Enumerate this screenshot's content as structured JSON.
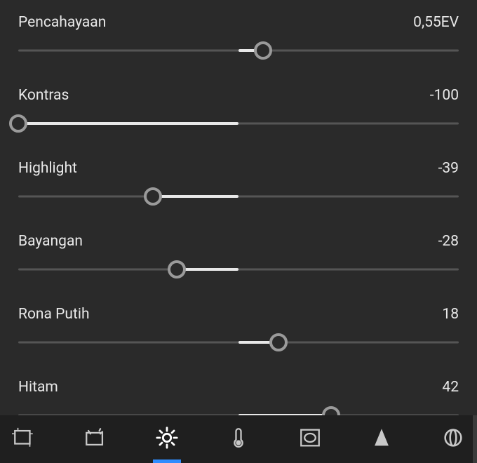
{
  "panel": {
    "sliders": [
      {
        "id": "exposure",
        "label": "Pencahayaan",
        "display": "0,55EV",
        "min": -5,
        "max": 5,
        "value": 0.55
      },
      {
        "id": "contrast",
        "label": "Kontras",
        "display": "-100",
        "min": -100,
        "max": 100,
        "value": -100
      },
      {
        "id": "highlight",
        "label": "Highlight",
        "display": "-39",
        "min": -100,
        "max": 100,
        "value": -39
      },
      {
        "id": "shadows",
        "label": "Bayangan",
        "display": "-28",
        "min": -100,
        "max": 100,
        "value": -28
      },
      {
        "id": "whites",
        "label": "Rona Putih",
        "display": "18",
        "min": -100,
        "max": 100,
        "value": 18
      },
      {
        "id": "blacks",
        "label": "Hitam",
        "display": "42",
        "min": -100,
        "max": 100,
        "value": 42
      }
    ]
  },
  "toolbar": {
    "items": [
      {
        "id": "crop",
        "active": false
      },
      {
        "id": "auto",
        "active": false
      },
      {
        "id": "light",
        "active": true
      },
      {
        "id": "temp",
        "active": false
      },
      {
        "id": "vignette",
        "active": false
      },
      {
        "id": "sharpen",
        "active": false
      },
      {
        "id": "optics",
        "active": false
      }
    ]
  }
}
